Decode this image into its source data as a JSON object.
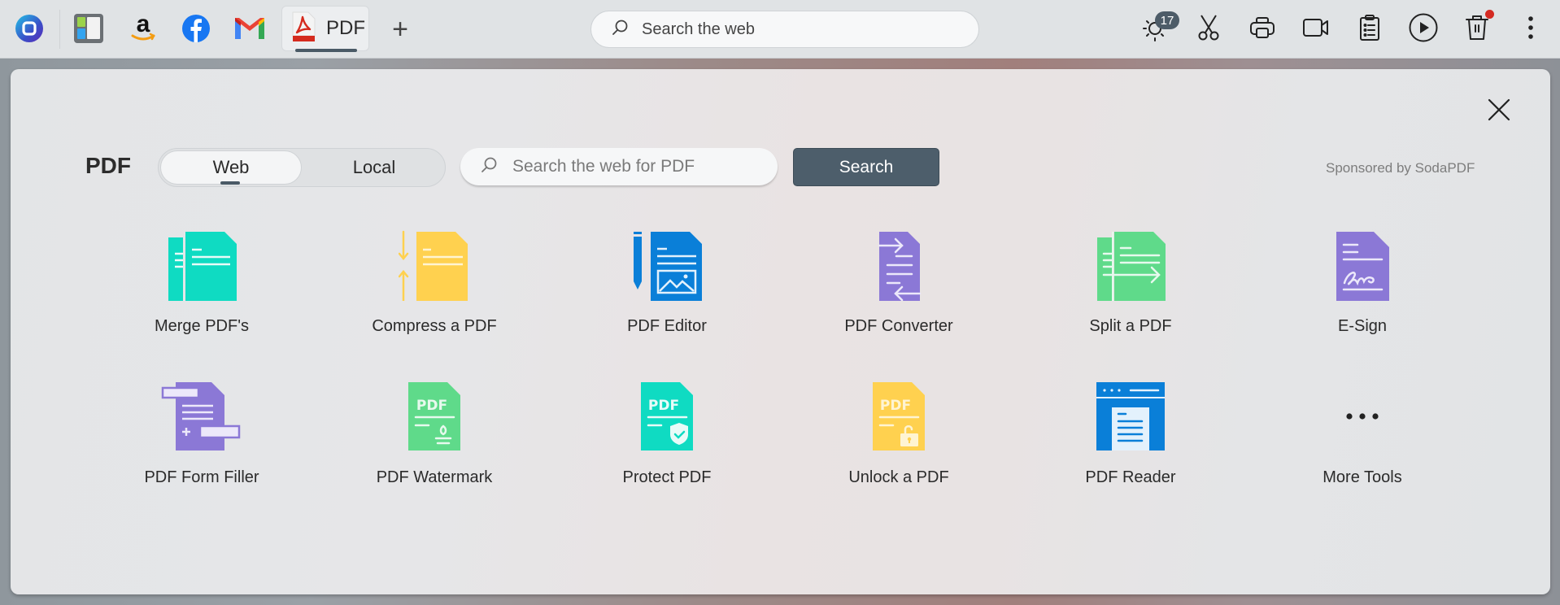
{
  "browser": {
    "pinned_tabs": [
      {
        "name": "browser-logo",
        "icon": "browser-logo-icon"
      },
      {
        "name": "sidebar-app",
        "icon": "sidebar-app-icon"
      },
      {
        "name": "amazon",
        "icon": "amazon-icon"
      },
      {
        "name": "facebook",
        "icon": "facebook-icon"
      },
      {
        "name": "gmail",
        "icon": "gmail-icon"
      }
    ],
    "active_tab": {
      "label": "PDF",
      "icon": "pdf-icon"
    },
    "new_tab_label": "+",
    "search": {
      "placeholder": "Search the web",
      "value": ""
    },
    "toolbar": {
      "weather_badge": "17",
      "tools": [
        "weather-icon",
        "scissors-icon",
        "print-icon",
        "video-icon",
        "clipboard-icon",
        "play-icon",
        "trash-icon",
        "more-vert-icon"
      ]
    }
  },
  "panel": {
    "title": "PDF",
    "toggle": {
      "options": [
        "Web",
        "Local"
      ],
      "selected": "Web"
    },
    "search": {
      "placeholder": "Search the web for PDF",
      "value": ""
    },
    "search_button": "Search",
    "sponsored": "Sponsored by SodaPDF",
    "colors": {
      "teal": "#0fdbc2",
      "yellow": "#ffd14f",
      "blue": "#0a7fd8",
      "purple": "#8b78d6",
      "green": "#5fda8a",
      "button": "#4d5e6b"
    },
    "tools": [
      {
        "label": "Merge PDF's",
        "icon": "merge-pdf-icon"
      },
      {
        "label": "Compress a PDF",
        "icon": "compress-pdf-icon"
      },
      {
        "label": "PDF Editor",
        "icon": "pdf-editor-icon"
      },
      {
        "label": "PDF Converter",
        "icon": "pdf-converter-icon"
      },
      {
        "label": "Split a PDF",
        "icon": "split-pdf-icon"
      },
      {
        "label": "E-Sign",
        "icon": "esign-icon"
      },
      {
        "label": "PDF Form Filler",
        "icon": "form-filler-icon"
      },
      {
        "label": "PDF Watermark",
        "icon": "watermark-icon"
      },
      {
        "label": "Protect PDF",
        "icon": "protect-pdf-icon"
      },
      {
        "label": "Unlock a PDF",
        "icon": "unlock-pdf-icon"
      },
      {
        "label": "PDF Reader",
        "icon": "pdf-reader-icon"
      },
      {
        "label": "More Tools",
        "icon": "more-horiz-icon"
      }
    ],
    "doc_label": "PDF"
  }
}
